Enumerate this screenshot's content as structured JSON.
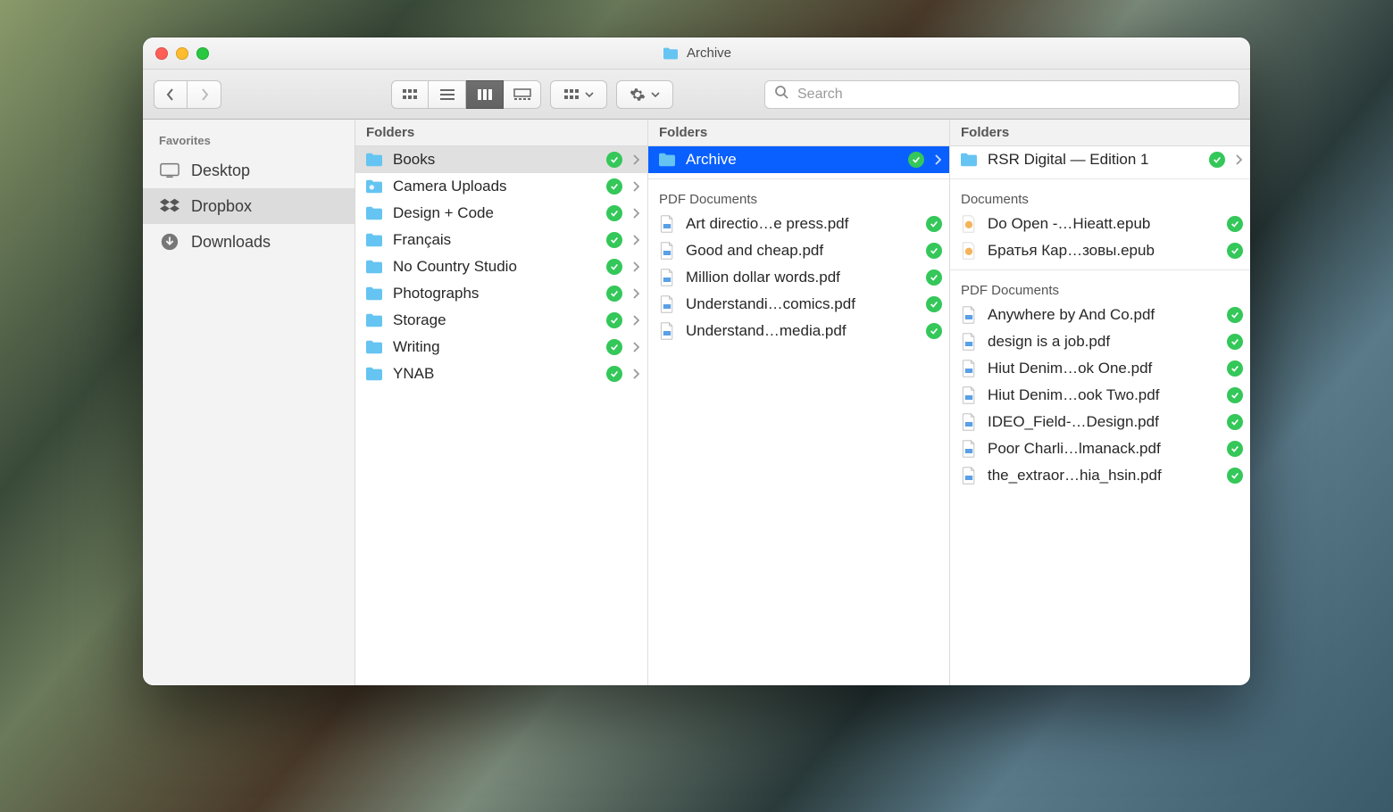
{
  "window": {
    "title": "Archive"
  },
  "search": {
    "placeholder": "Search"
  },
  "sidebar": {
    "header": "Favorites",
    "items": [
      {
        "label": "Desktop",
        "icon": "desktop",
        "selected": false
      },
      {
        "label": "Dropbox",
        "icon": "dropbox",
        "selected": true
      },
      {
        "label": "Downloads",
        "icon": "download",
        "selected": false
      }
    ]
  },
  "columns": [
    {
      "header": "Folders",
      "groups": [
        {
          "label": null,
          "items": [
            {
              "name": "Books",
              "type": "folder",
              "synced": true,
              "drill": true,
              "selected": "gray"
            },
            {
              "name": "Camera Uploads",
              "type": "folder-photos",
              "synced": true,
              "drill": true
            },
            {
              "name": "Design + Code",
              "type": "folder",
              "synced": true,
              "drill": true
            },
            {
              "name": "Français",
              "type": "folder",
              "synced": true,
              "drill": true
            },
            {
              "name": "No Country Studio",
              "type": "folder",
              "synced": true,
              "drill": true
            },
            {
              "name": "Photographs",
              "type": "folder",
              "synced": true,
              "drill": true
            },
            {
              "name": "Storage",
              "type": "folder",
              "synced": true,
              "drill": true
            },
            {
              "name": "Writing",
              "type": "folder",
              "synced": true,
              "drill": true
            },
            {
              "name": "YNAB",
              "type": "folder",
              "synced": true,
              "drill": true
            }
          ]
        }
      ]
    },
    {
      "header": "Folders",
      "groups": [
        {
          "label": null,
          "items": [
            {
              "name": "Archive",
              "type": "folder",
              "synced": true,
              "drill": true,
              "selected": "blue"
            }
          ]
        },
        {
          "label": "PDF Documents",
          "items": [
            {
              "name": "Art directio…e press.pdf",
              "type": "pdf",
              "synced": true
            },
            {
              "name": "Good and cheap.pdf",
              "type": "pdf",
              "synced": true
            },
            {
              "name": "Million dollar words.pdf",
              "type": "pdf",
              "synced": true
            },
            {
              "name": "Understandi…comics.pdf",
              "type": "pdf",
              "synced": true
            },
            {
              "name": "Understand…media.pdf",
              "type": "pdf",
              "synced": true
            }
          ]
        }
      ]
    },
    {
      "header": "Folders",
      "groups": [
        {
          "label": null,
          "items": [
            {
              "name": "RSR Digital — Edition 1",
              "type": "folder",
              "synced": true,
              "drill": true
            }
          ]
        },
        {
          "label": "Documents",
          "items": [
            {
              "name": "Do Open -…Hieatt.epub",
              "type": "epub",
              "synced": true
            },
            {
              "name": "Братья Кар…зовы.epub",
              "type": "epub",
              "synced": true
            }
          ]
        },
        {
          "label": "PDF Documents",
          "items": [
            {
              "name": "Anywhere by And Co.pdf",
              "type": "pdf",
              "synced": true
            },
            {
              "name": "design is a job.pdf",
              "type": "pdf",
              "synced": true
            },
            {
              "name": "Hiut Denim…ok One.pdf",
              "type": "pdf",
              "synced": true
            },
            {
              "name": "Hiut Denim…ook Two.pdf",
              "type": "pdf",
              "synced": true
            },
            {
              "name": "IDEO_Field-…Design.pdf",
              "type": "pdf",
              "synced": true
            },
            {
              "name": "Poor Charli…lmanack.pdf",
              "type": "pdf",
              "synced": true
            },
            {
              "name": "the_extraor…hia_hsin.pdf",
              "type": "pdf",
              "synced": true
            }
          ]
        }
      ]
    }
  ]
}
